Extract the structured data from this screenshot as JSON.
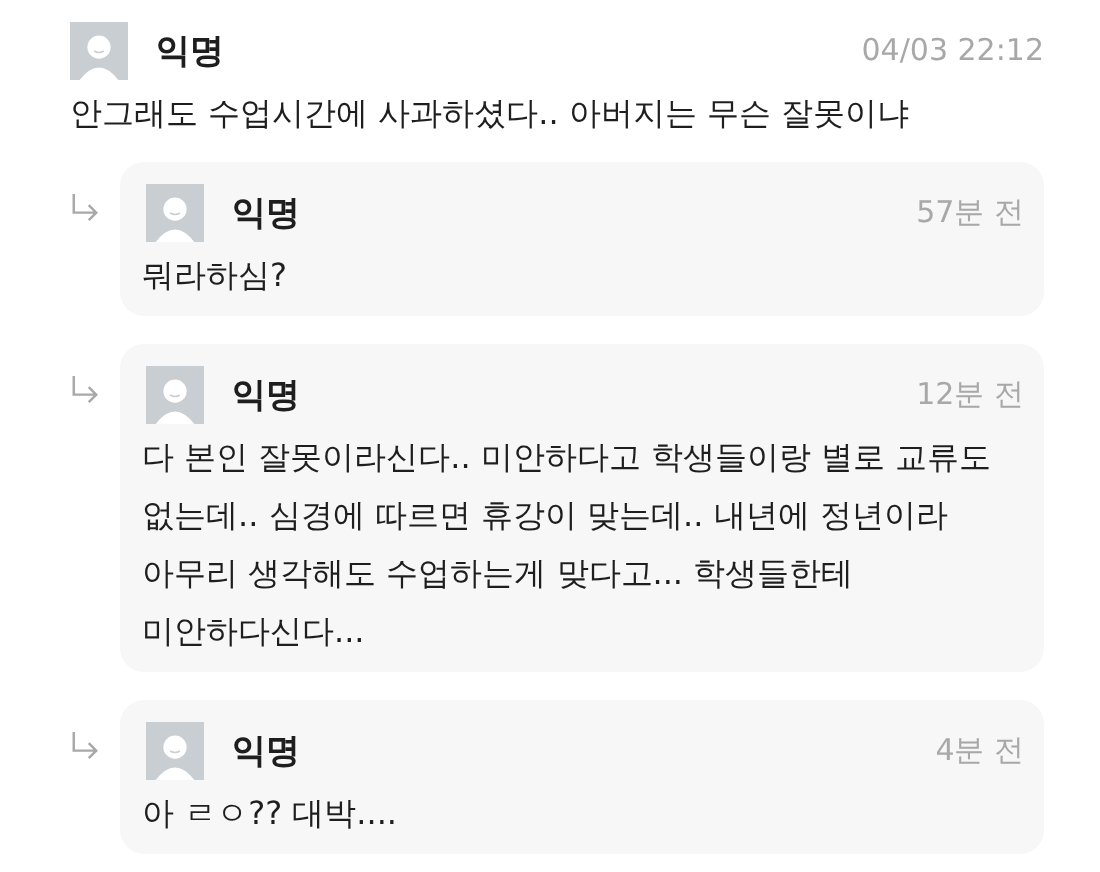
{
  "post": {
    "author": "익명",
    "time": "04/03 22:12",
    "text": "안그래도 수업시간에 사과하셨다.. 아버지는 무슨 잘못이냐"
  },
  "replies": [
    {
      "author": "익명",
      "time": "57분 전",
      "text": "뭐라하심?"
    },
    {
      "author": "익명",
      "time": "12분 전",
      "text": "다 본인 잘못이라신다.. 미안하다고 학생들이랑 별로 교류도 없는데.. 심경에 따르면 휴강이 맞는데.. 내년에 정년이라 아무리 생각해도 수업하는게 맞다고... 학생들한테 미안하다신다..."
    },
    {
      "author": "익명",
      "time": "4분 전",
      "text": "아 ㄹㅇ?? 대박...."
    }
  ]
}
